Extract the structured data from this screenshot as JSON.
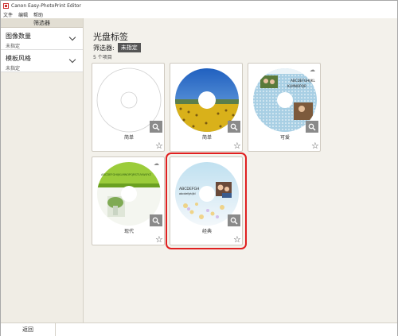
{
  "window": {
    "title": "Canon Easy-PhotoPrint Editor"
  },
  "menu": [
    "文件",
    "编辑",
    "帮助"
  ],
  "sidebar": {
    "header": "筛选器",
    "filters": [
      {
        "title": "图像数量",
        "value": "未指定"
      },
      {
        "title": "模板风格",
        "value": "未指定"
      }
    ]
  },
  "main": {
    "title": "光盘标签",
    "filter_label": "筛选器:",
    "filter_value": "未指定",
    "count": "5 个项目",
    "templates": [
      {
        "label": "简单",
        "style": "plain",
        "selected": false,
        "cloud": false
      },
      {
        "label": "简单",
        "style": "sunflower",
        "selected": false,
        "cloud": false
      },
      {
        "label": "可爱",
        "style": "cute",
        "selected": false,
        "cloud": true
      },
      {
        "label": "现代",
        "style": "modern",
        "selected": false,
        "cloud": true
      },
      {
        "label": "经典",
        "style": "classic",
        "selected": true,
        "cloud": false
      }
    ]
  },
  "footer": {
    "back": "返回"
  },
  "disc_text": {
    "cute_line1": "ABCDEFGHIJKL",
    "cute_line2": "KLMNOPQR",
    "modern_text": "ABCDEFGHIJKLMNOPQRSTUVWXYZ",
    "classic_line1": "ABCDEFGH",
    "classic_line2": "abcdefghijkl"
  },
  "colors": {
    "selected_outline": "#e02020",
    "zoom_button": "#8a8a8a",
    "sidebar_bg": "#f0ede5",
    "main_bg": "#f3f1eb"
  }
}
